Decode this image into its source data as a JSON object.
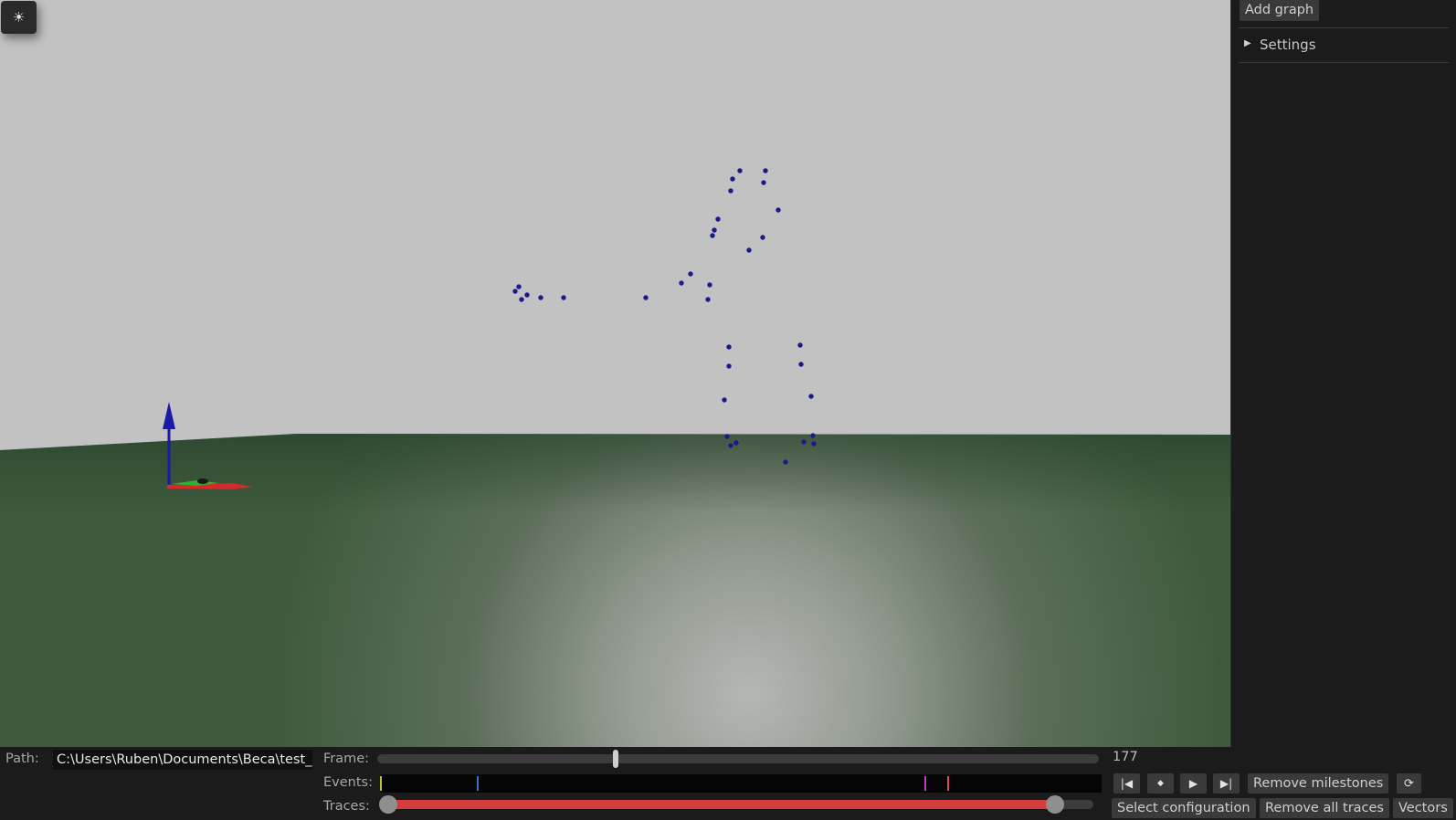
{
  "theme_toggle": {
    "icon": "sun-icon",
    "glyph": "☀"
  },
  "side_panel": {
    "add_graph_label": "Add graph",
    "settings_label": "Settings",
    "settings_glyph": "▶"
  },
  "bottom_bar": {
    "path_label": "Path:",
    "path_value": "C:\\Users\\Ruben\\Documents\\Beca\\test_",
    "frame_label": "Frame:",
    "frame_value": "177",
    "frame_position": 0.33,
    "events_label": "Events:",
    "events": [
      {
        "position": 0.0,
        "color": "#b8c23a"
      },
      {
        "position": 0.134,
        "color": "#3a6fc4"
      },
      {
        "position": 0.755,
        "color": "#c23ac2"
      },
      {
        "position": 0.786,
        "color": "#d44a5a"
      }
    ],
    "traces_label": "Traces:",
    "traces_range": [
      0.0,
      0.945
    ],
    "traces_color": "#d43d3d",
    "controls": {
      "skip_back_glyph": "|◀",
      "milestone_glyph": "◆",
      "play_glyph": "▶",
      "skip_forward_glyph": "▶|",
      "remove_milestones_label": "Remove milestones",
      "refresh_glyph": "⟳",
      "select_configuration_label": "Select configuration",
      "remove_all_traces_label": "Remove all traces",
      "vectors_label": "Vectors"
    }
  },
  "colors": {
    "sky": "#c2c2c2",
    "ground": "#3e5a3e",
    "marker": "#1a1a8c",
    "axis_x": "#d42a2a",
    "axis_y": "#2fb02f",
    "axis_z": "#1a1aa8"
  }
}
